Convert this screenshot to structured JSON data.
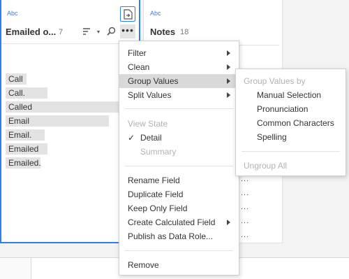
{
  "card1": {
    "type_label": "Abc",
    "title": "Emailed o...",
    "count": "7",
    "values": [
      "Call",
      "Call.",
      "Called",
      "Email",
      "Email.",
      "Emailed",
      "Emailed."
    ]
  },
  "card2": {
    "type_label": "Abc",
    "title": "Notes",
    "count": "18",
    "more_dots": "..."
  },
  "icons": {
    "recommend": "recommendations-icon",
    "sort": "sort-icon",
    "search": "search-icon",
    "more": "more-options-icon"
  },
  "main_menu": {
    "filter": "Filter",
    "clean": "Clean",
    "group_values": "Group Values",
    "split_values": "Split Values",
    "view_state": "View State",
    "detail": "Detail",
    "summary": "Summary",
    "rename_field": "Rename Field",
    "duplicate_field": "Duplicate Field",
    "keep_only_field": "Keep Only Field",
    "create_calculated_field": "Create Calculated Field",
    "publish_as_data_role": "Publish as Data Role...",
    "remove": "Remove"
  },
  "sub_menu": {
    "header": "Group Values by",
    "manual_selection": "Manual Selection",
    "pronunciation": "Pronunciation",
    "common_characters": "Common Characters",
    "spelling": "Spelling",
    "ungroup_all": "Ungroup All"
  },
  "colors": {
    "accent": "#2f80ed",
    "bar": "#e3e3e3",
    "highlight": "#d9d9d9",
    "disabled_text": "#b3b3b3"
  }
}
